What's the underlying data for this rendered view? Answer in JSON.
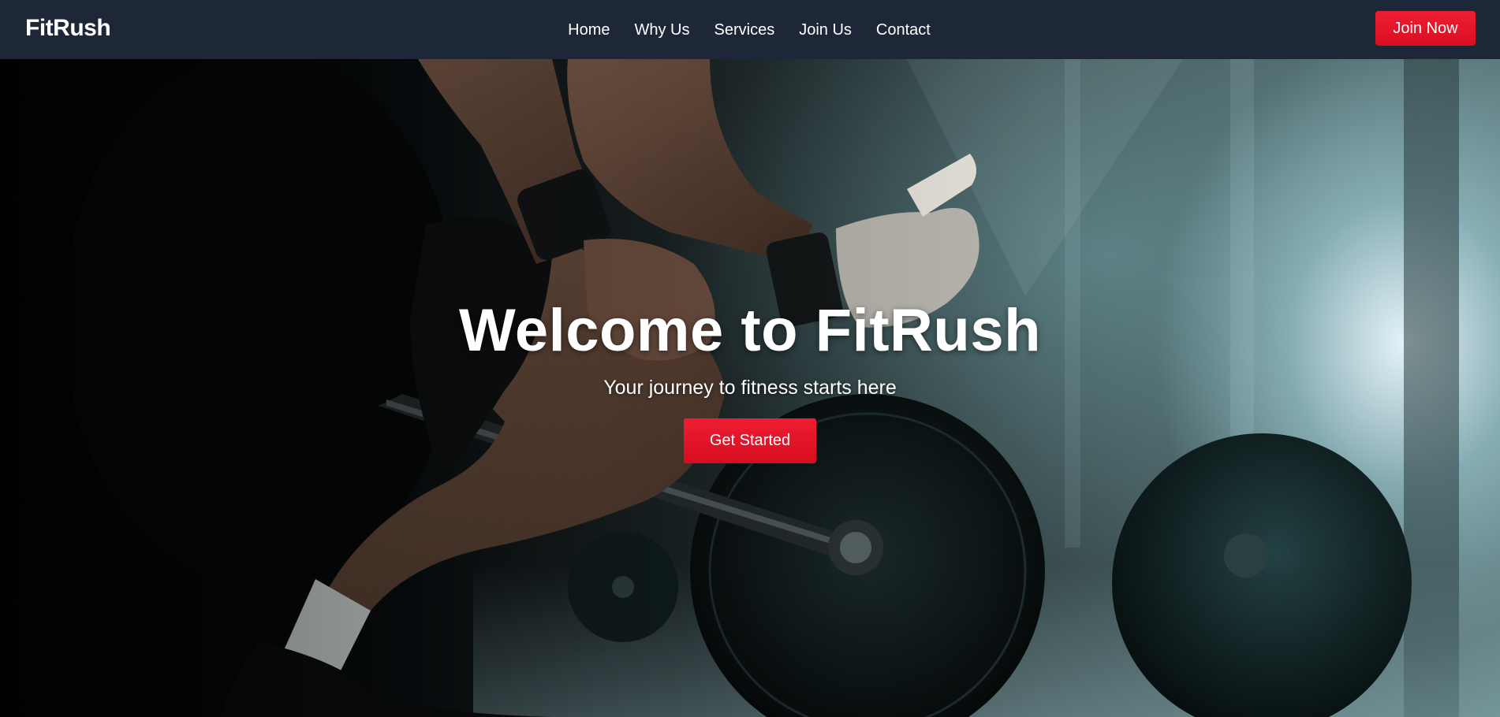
{
  "brand": {
    "name": "FitRush"
  },
  "nav": {
    "links": [
      "Home",
      "Why Us",
      "Services",
      "Join Us",
      "Contact"
    ],
    "cta_label": "Join Now"
  },
  "hero": {
    "title": "Welcome to FitRush",
    "subtitle": "Your journey to fitness starts here",
    "cta_label": "Get Started",
    "background_image": "gym-deadlift-barbell-photo"
  },
  "colors": {
    "navbar_bg": "#1e2738",
    "accent_red": "#e8172b",
    "text": "#ffffff"
  }
}
